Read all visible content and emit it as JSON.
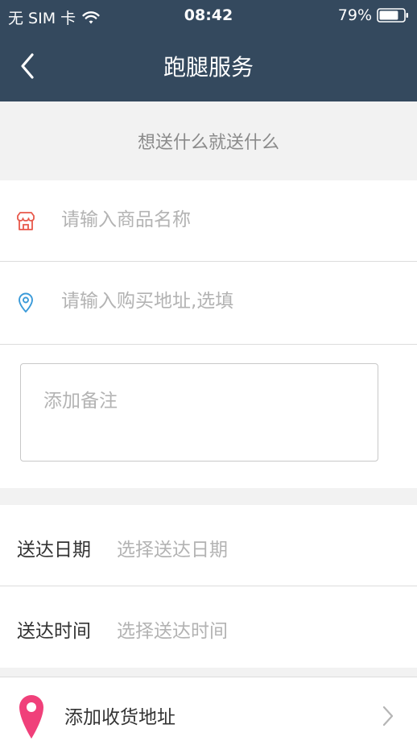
{
  "status_bar": {
    "carrier": "无 SIM 卡",
    "time": "08:42",
    "battery": "79%",
    "battery_level": 0.79,
    "icons": [
      "wifi-icon",
      "battery-icon"
    ]
  },
  "nav": {
    "title": "跑腿服务",
    "back_icon": "back-chevron-icon"
  },
  "slogan": "想送什么就送什么",
  "form": {
    "product_name": {
      "value": "",
      "placeholder": "请输入商品名称",
      "icon": "shop-icon"
    },
    "purchase_address": {
      "value": "",
      "placeholder": "请输入购买地址,选填",
      "icon": "location-pin-icon"
    },
    "notes": {
      "value": "",
      "placeholder": "添加备注"
    }
  },
  "delivery": {
    "date_label": "送达日期",
    "date_placeholder": "选择送达日期",
    "time_label": "送达时间",
    "time_placeholder": "选择送达时间"
  },
  "address": {
    "label": "添加收货地址",
    "icon": "map-pin-icon",
    "arrow_icon": "chevron-right-icon"
  },
  "colors": {
    "header_bg": "#34495e",
    "page_bg": "#f2f2f2",
    "shop_icon": "#e8584a",
    "location_icon": "#3a9ad9",
    "map_pin": "#f0407a",
    "placeholder": "#b3b3b3",
    "text": "#333333"
  }
}
